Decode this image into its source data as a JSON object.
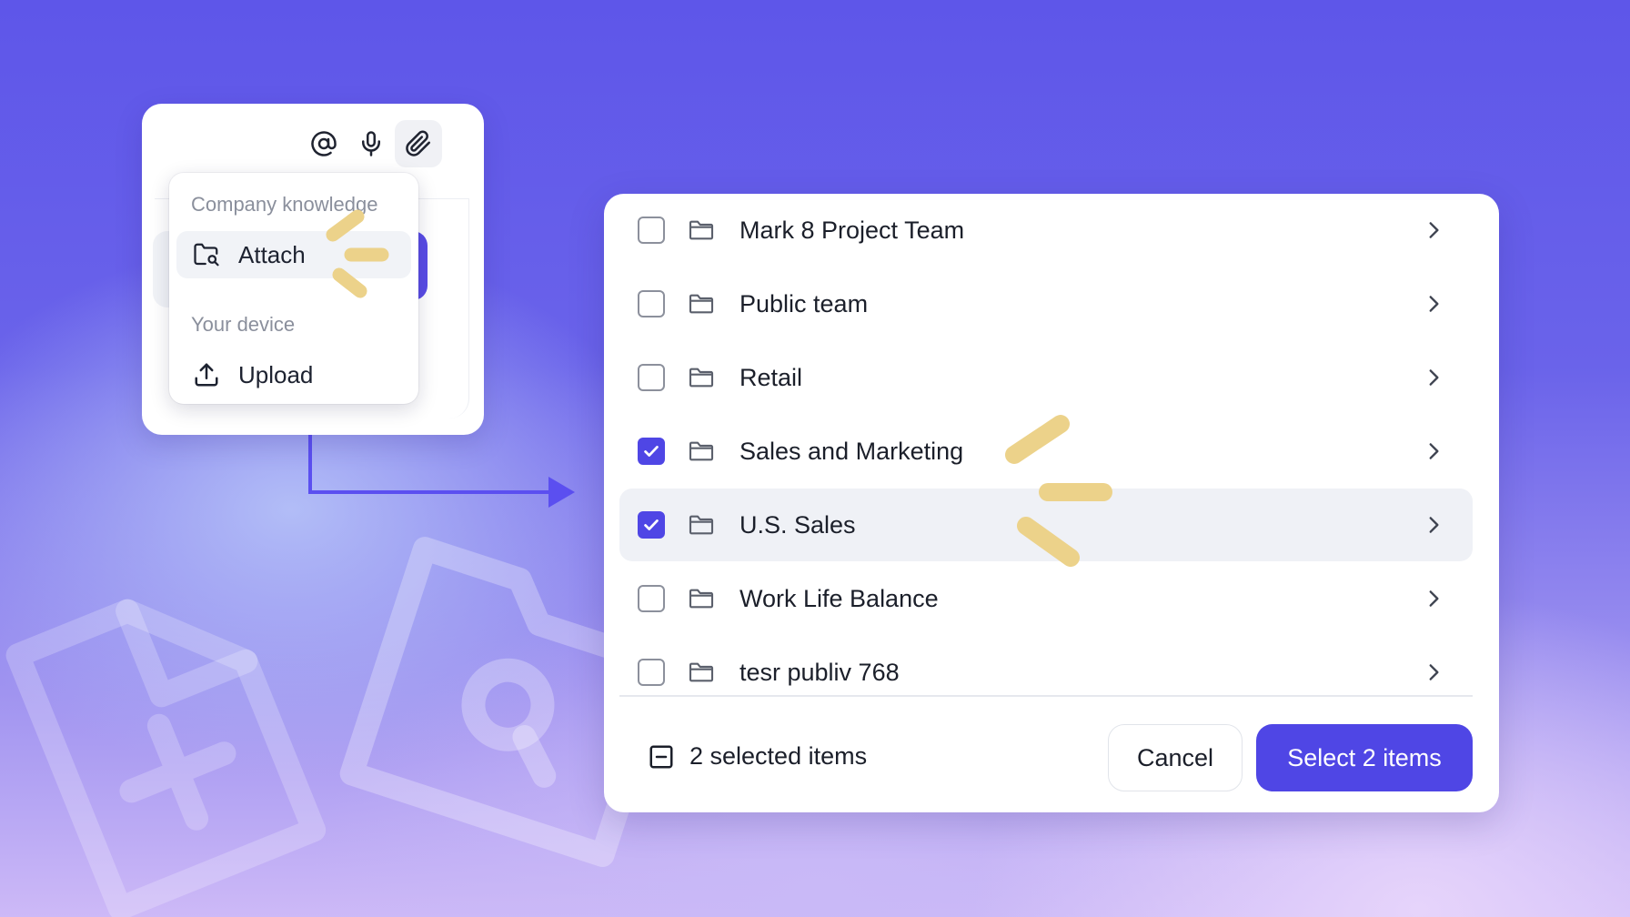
{
  "colors": {
    "accent": "#4f46e5",
    "highlight_marks": "#ecd28a",
    "arrow": "#5b4ff0"
  },
  "composer": {
    "toolbar": [
      "at-sign-icon",
      "microphone-icon",
      "paperclip-icon"
    ],
    "menu": {
      "section_company": "Company knowledge",
      "attach_label": "Attach",
      "section_device": "Your device",
      "upload_label": "Upload"
    }
  },
  "picker": {
    "folders": [
      {
        "name": "Mark 8 Project Team",
        "checked": false
      },
      {
        "name": "Public team",
        "checked": false
      },
      {
        "name": "Retail",
        "checked": false
      },
      {
        "name": "Sales and Marketing",
        "checked": true
      },
      {
        "name": "U.S. Sales",
        "checked": true,
        "highlighted": true
      },
      {
        "name": "Work Life Balance",
        "checked": false
      },
      {
        "name": "tesr publiv 768",
        "checked": false
      }
    ],
    "footer": {
      "selected_count": "2 selected items",
      "cancel_label": "Cancel",
      "confirm_label": "Select 2 items"
    }
  }
}
